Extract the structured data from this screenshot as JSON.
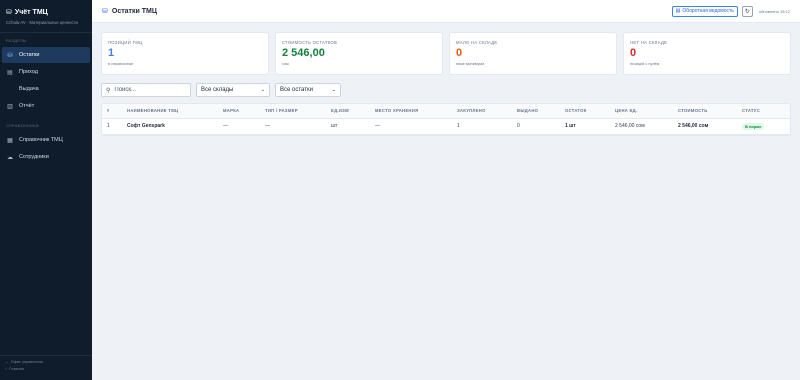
{
  "app": {
    "title": "Учёт ТМЦ",
    "subtitle": "Cсhala-AV · Материальные ценности",
    "title_icon": "boxes-icon"
  },
  "sidebar": {
    "section_main": "Разделы",
    "section_ref": "Справочники",
    "items": [
      {
        "label": "Остатки",
        "icon": "boxes-icon",
        "active": true
      },
      {
        "label": "Приход",
        "icon": "truck-icon",
        "active": false
      },
      {
        "label": "Выдача",
        "icon": "arrow-out-icon",
        "active": false
      },
      {
        "label": "Отчёт",
        "icon": "report-icon",
        "active": false
      }
    ],
    "ref_items": [
      {
        "label": "Справочник ТМЦ",
        "icon": "list-icon"
      },
      {
        "label": "Сотрудники",
        "icon": "users-icon"
      }
    ],
    "footer": {
      "link1": "Офис управления",
      "link2": "Главная"
    }
  },
  "header": {
    "title": "Остатки ТМЦ",
    "report_button": "Оборотная ведомость",
    "updated": "обновлено 15:12"
  },
  "cards": [
    {
      "label": "Позиций ТМЦ",
      "value": "1",
      "sub": "в справочнике",
      "color": "#3b82f6"
    },
    {
      "label": "Стоимость остатков",
      "value": "2 546,00",
      "sub": "сом",
      "color": "#15803d"
    },
    {
      "label": "Мало на складе",
      "value": "0",
      "sub": "ниже минимума",
      "color": "#ea580c"
    },
    {
      "label": "Нет на складе",
      "value": "0",
      "sub": "позиций с нулём",
      "color": "#dc2626"
    }
  ],
  "filters": {
    "search_placeholder": "Поиск...",
    "warehouse": "Все склады",
    "stock": "Все остатки"
  },
  "table": {
    "columns": [
      "#",
      "Наименование ТМЦ",
      "Марка",
      "Тип / размер",
      "Ед.изм",
      "Место хранения",
      "Закуплено",
      "Выдано",
      "Остаток",
      "Цена ед.",
      "Стоимость",
      "Статус"
    ],
    "rows": [
      {
        "num": "1",
        "name": "Софт Genspark",
        "brand": "—",
        "type": "—",
        "unit": "шт",
        "place": "—",
        "bought": "1",
        "issued": "0",
        "rest": "1 шт",
        "price": "2 546,00 сом",
        "cost": "2 546,00 сом",
        "status": "В норме"
      }
    ]
  }
}
